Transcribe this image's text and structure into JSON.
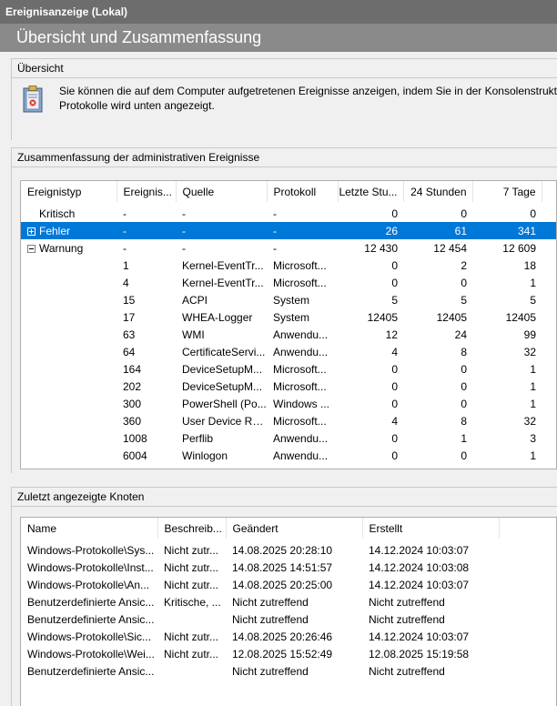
{
  "window": {
    "title": "Ereignisanzeige (Lokal)"
  },
  "header": {
    "title": "Übersicht und Zusammenfassung"
  },
  "overview": {
    "title": "Übersicht",
    "text_line1": "Sie können die auf dem Computer aufgetretenen Ereignisse anzeigen, indem Sie in der Konsolenstruktur",
    "text_line2": "Protokolle wird unten angezeigt."
  },
  "summary": {
    "title": "Zusammenfassung der administrativen Ereignisse",
    "columns": [
      "Ereignistyp",
      "Ereignis...",
      "Quelle",
      "Protokoll",
      "Letzte Stu...",
      "24 Stunden",
      "7 Tage"
    ],
    "rows": [
      {
        "type": "Kritisch",
        "id": "-",
        "source": "-",
        "log": "-",
        "last": "0",
        "h24": "0",
        "d7": "0",
        "toggle": "none"
      },
      {
        "type": "Fehler",
        "id": "-",
        "source": "-",
        "log": "-",
        "last": "26",
        "h24": "61",
        "d7": "341",
        "toggle": "plus",
        "selected": true
      },
      {
        "type": "Warnung",
        "id": "-",
        "source": "-",
        "log": "-",
        "last": "12 430",
        "h24": "12 454",
        "d7": "12 609",
        "toggle": "minus"
      },
      {
        "type": "",
        "id": "1",
        "source": "Kernel-EventTr...",
        "log": "Microsoft...",
        "last": "0",
        "h24": "2",
        "d7": "18"
      },
      {
        "type": "",
        "id": "4",
        "source": "Kernel-EventTr...",
        "log": "Microsoft...",
        "last": "0",
        "h24": "0",
        "d7": "1"
      },
      {
        "type": "",
        "id": "15",
        "source": "ACPI",
        "log": "System",
        "last": "5",
        "h24": "5",
        "d7": "5"
      },
      {
        "type": "",
        "id": "17",
        "source": "WHEA-Logger",
        "log": "System",
        "last": "12405",
        "h24": "12405",
        "d7": "12405"
      },
      {
        "type": "",
        "id": "63",
        "source": "WMI",
        "log": "Anwendu...",
        "last": "12",
        "h24": "24",
        "d7": "99"
      },
      {
        "type": "",
        "id": "64",
        "source": "CertificateServi...",
        "log": "Anwendu...",
        "last": "4",
        "h24": "8",
        "d7": "32"
      },
      {
        "type": "",
        "id": "164",
        "source": "DeviceSetupM...",
        "log": "Microsoft...",
        "last": "0",
        "h24": "0",
        "d7": "1"
      },
      {
        "type": "",
        "id": "202",
        "source": "DeviceSetupM...",
        "log": "Microsoft...",
        "last": "0",
        "h24": "0",
        "d7": "1"
      },
      {
        "type": "",
        "id": "300",
        "source": "PowerShell (Po...",
        "log": "Windows ...",
        "last": "0",
        "h24": "0",
        "d7": "1"
      },
      {
        "type": "",
        "id": "360",
        "source": "User Device Re...",
        "log": "Microsoft...",
        "last": "4",
        "h24": "8",
        "d7": "32"
      },
      {
        "type": "",
        "id": "1008",
        "source": "Perflib",
        "log": "Anwendu...",
        "last": "0",
        "h24": "1",
        "d7": "3"
      },
      {
        "type": "",
        "id": "6004",
        "source": "Winlogon",
        "log": "Anwendu...",
        "last": "0",
        "h24": "0",
        "d7": "1"
      }
    ]
  },
  "recent": {
    "title": "Zuletzt angezeigte Knoten",
    "columns": [
      "Name",
      "Beschreib...",
      "Geändert",
      "Erstellt"
    ],
    "rows": [
      {
        "name": "Windows-Protokolle\\Sys...",
        "desc": "Nicht zutr...",
        "changed": "14.08.2025 20:28:10",
        "created": "14.12.2024 10:03:07"
      },
      {
        "name": "Windows-Protokolle\\Inst...",
        "desc": "Nicht zutr...",
        "changed": "14.08.2025 14:51:57",
        "created": "14.12.2024 10:03:08"
      },
      {
        "name": "Windows-Protokolle\\An...",
        "desc": "Nicht zutr...",
        "changed": "14.08.2025 20:25:00",
        "created": "14.12.2024 10:03:07"
      },
      {
        "name": "Benutzerdefinierte Ansic...",
        "desc": "Kritische, ...",
        "changed": "Nicht zutreffend",
        "created": "Nicht zutreffend"
      },
      {
        "name": "Benutzerdefinierte Ansic...",
        "desc": "",
        "changed": "Nicht zutreffend",
        "created": "Nicht zutreffend"
      },
      {
        "name": "Windows-Protokolle\\Sic...",
        "desc": "Nicht zutr...",
        "changed": "14.08.2025 20:26:46",
        "created": "14.12.2024 10:03:07"
      },
      {
        "name": "Windows-Protokolle\\Wei...",
        "desc": "Nicht zutr...",
        "changed": "12.08.2025 15:52:49",
        "created": "12.08.2025 15:19:58"
      },
      {
        "name": "Benutzerdefinierte Ansic...",
        "desc": "",
        "changed": "Nicht zutreffend",
        "created": "Nicht zutreffend"
      }
    ]
  }
}
